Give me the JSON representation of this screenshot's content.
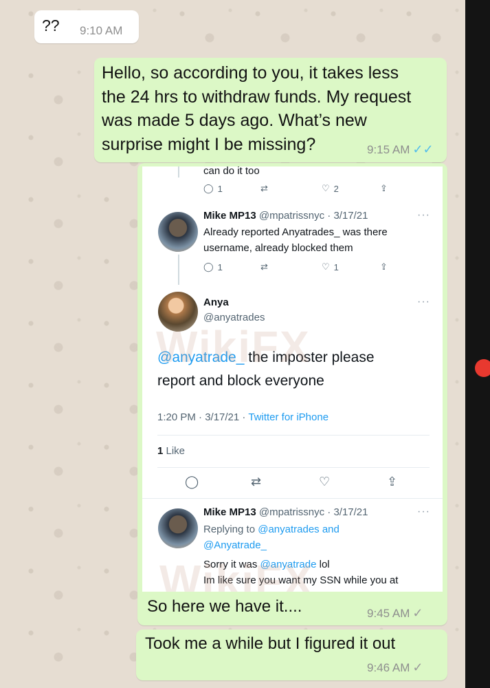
{
  "messages": [
    {
      "text": "??",
      "time": "9:10 AM"
    },
    {
      "lines": [
        "Hello, so according to you, it takes less",
        "the 24 hrs to withdraw funds. My request",
        "was made 5 days ago. What’s new",
        "surprise might I be missing?"
      ],
      "time": "9:15 AM"
    },
    {
      "text": "So here we have it....",
      "time": "9:45 AM"
    },
    {
      "text": "Took me a while but I figured it out",
      "time": "9:46 AM"
    }
  ],
  "tweet_shot": {
    "top_partial": "can do it too",
    "row1": {
      "replies": "1",
      "likes": "2"
    },
    "reply1": {
      "name": "Mike MP13",
      "handle_date": "@mpatrissnyc · 3/17/21",
      "lines": [
        "Already reported Anyatrades_ was there",
        "username, already blocked them"
      ],
      "replies": "1",
      "likes": "1"
    },
    "main": {
      "name": "Anya",
      "handle": "@anyatrades",
      "mention": "@anyatrade_",
      "text_rest": " the imposter please",
      "text_line2": "report and block everyone",
      "time_date": "1:20 PM · 3/17/21 · ",
      "source": "Twitter for iPhone",
      "like_count": "1",
      "like_label": " Like"
    },
    "reply2": {
      "name": "Mike MP13",
      "handle_date": "@mpatrissnyc · 3/17/21",
      "replying_prefix": "Replying to ",
      "replying_to_1": "@anyatrades",
      "replying_and": " and",
      "replying_to_2": "@Anyatrade_",
      "line1_prefix": "Sorry it was ",
      "line1_mention": "@anyatrade",
      "line1_suffix": " lol",
      "line2": "Im like sure you want my SSN while you at"
    }
  },
  "watermark": "WikiFX",
  "colors": {
    "outgoing": "#dcf8c6",
    "incoming": "#ffffff",
    "link": "#1d9bf0",
    "read_tick": "#53bdeb"
  }
}
